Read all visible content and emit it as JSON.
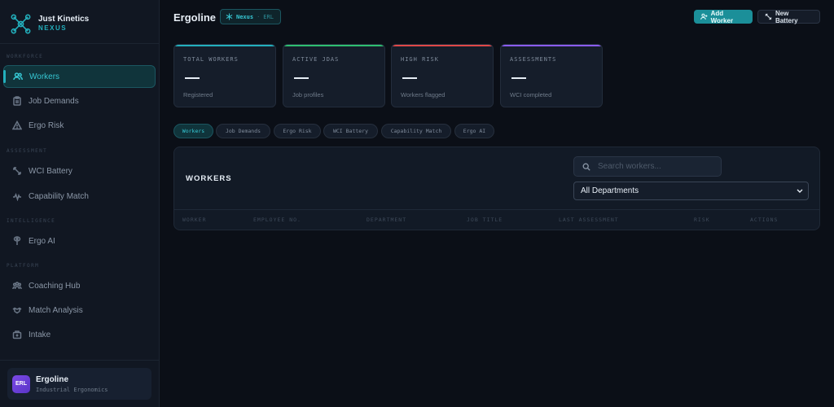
{
  "brand": {
    "name": "Just Kinetics",
    "product": "NEXUS"
  },
  "sidebar": {
    "sections": [
      {
        "label": "WORKFORCE"
      },
      {
        "label": "ASSESSMENT"
      },
      {
        "label": "INTELLIGENCE"
      },
      {
        "label": "PLATFORM"
      }
    ],
    "items": [
      {
        "label": "Workers",
        "icon": "users-icon",
        "active": true
      },
      {
        "label": "Job Demands",
        "icon": "clipboard-icon"
      },
      {
        "label": "Ergo Risk",
        "icon": "warning-icon"
      },
      {
        "label": "WCI Battery",
        "icon": "expand-icon"
      },
      {
        "label": "Capability Match",
        "icon": "activity-icon"
      },
      {
        "label": "Ergo AI",
        "icon": "brain-icon"
      },
      {
        "label": "Coaching Hub",
        "icon": "group-icon"
      },
      {
        "label": "Match Analysis",
        "icon": "handshake-icon"
      },
      {
        "label": "Intake",
        "icon": "medical-bag-icon"
      }
    ],
    "org": {
      "initials": "ERL",
      "name": "Ergoline",
      "description": "Industrial Ergonomics"
    }
  },
  "header": {
    "title": "Ergoline",
    "tag": {
      "name": "Nexus",
      "code": "ERL"
    },
    "add_worker_label": "Add Worker",
    "new_battery_label": "New Battery"
  },
  "stats": [
    {
      "label": "TOTAL WORKERS",
      "value": "—",
      "sub": "Registered",
      "color": "#23b0bd"
    },
    {
      "label": "ACTIVE JDAS",
      "value": "—",
      "sub": "Job profiles",
      "color": "#2fbf71"
    },
    {
      "label": "HIGH RISK",
      "value": "—",
      "sub": "Workers flagged",
      "color": "#e04848"
    },
    {
      "label": "ASSESSMENTS",
      "value": "—",
      "sub": "WCI completed",
      "color": "#8b5cf6"
    }
  ],
  "tabs": [
    {
      "label": "Workers",
      "active": true
    },
    {
      "label": "Job Demands"
    },
    {
      "label": "Ergo Risk"
    },
    {
      "label": "WCI Battery"
    },
    {
      "label": "Capability Match"
    },
    {
      "label": "Ergo AI"
    }
  ],
  "workers": {
    "title": "WORKERS",
    "search_placeholder": "Search workers...",
    "department_selected": "All Departments",
    "columns": [
      "WORKER",
      "EMPLOYEE NO.",
      "DEPARTMENT",
      "JOB TITLE",
      "LAST ASSESSMENT",
      "RISK",
      "ACTIONS"
    ]
  }
}
